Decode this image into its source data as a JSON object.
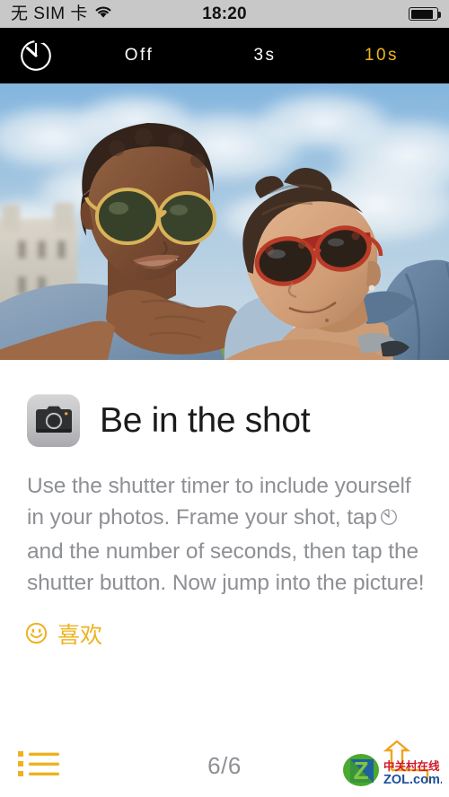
{
  "status_bar": {
    "carrier": "无 SIM 卡",
    "wifi_icon": "wifi-icon",
    "time": "18:20",
    "battery_icon": "battery-icon",
    "battery_level_pct": 80
  },
  "camera_toolbar": {
    "timer_icon": "timer-icon",
    "options": [
      {
        "label": "Off",
        "selected": false
      },
      {
        "label": "3s",
        "selected": false
      },
      {
        "label": "10s",
        "selected": true
      }
    ],
    "selected_color": "#f0b41d",
    "background_color": "#000000"
  },
  "photo": {
    "alt_name": "two-friends-outdoors-photo"
  },
  "tip": {
    "app_icon": "camera-app-icon",
    "title": "Be in the shot",
    "body": "Use the shutter timer to include yourself in your photos. Frame your shot, tap ⏱ and the number of seconds, then tap the shutter button. Now jump into the picture!",
    "body_part_1": "Use the shutter timer to include yourself in your photos. Frame your shot, tap",
    "body_part_2": "and the number of seconds, then tap the shutter button. Now jump into the picture!",
    "like_icon": "smiley-icon",
    "like_label": "喜欢",
    "like_color": "#edb21f"
  },
  "bottom_bar": {
    "list_icon": "list-icon",
    "page_counter": "6/6",
    "watermark": {
      "logo_letter": "Z",
      "chinese_text": "中关村在线",
      "domain_text": "ZOL.com.cn"
    }
  }
}
